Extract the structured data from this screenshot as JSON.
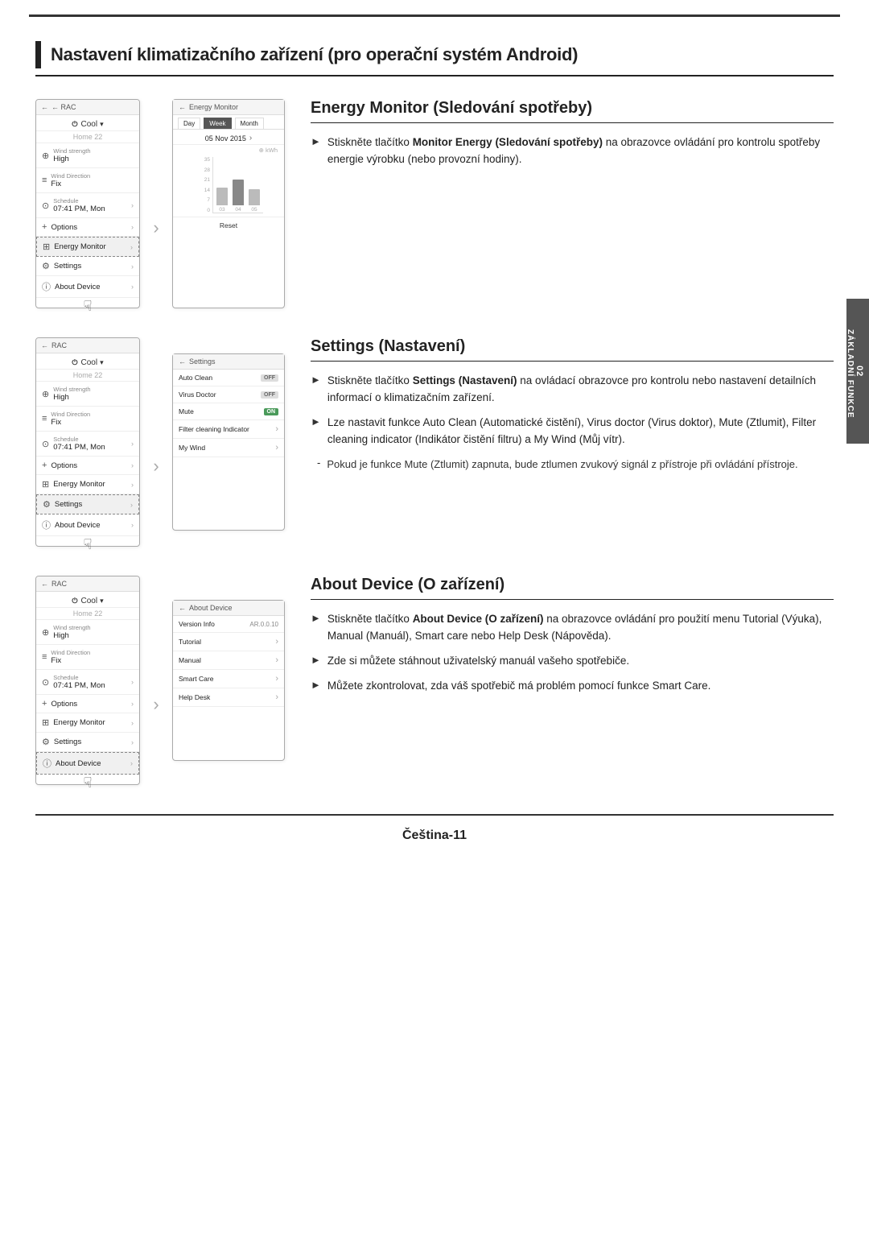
{
  "page": {
    "title": "Nastavení klimatizačního zařízení (pro operační systém Android)",
    "footer": "Čeština-11",
    "sideTab": {
      "number": "02",
      "label": "ZÁKLADNÍ FUNKCE"
    }
  },
  "sections": [
    {
      "id": "energy-monitor",
      "heading": "Energy Monitor (Sledování spotřeby)",
      "bullets": [
        {
          "text": "Stiskněte tlačítko Monitor Energy (Sledování spotřeby) na obrazovce ovládání pro kontrolu spotřeby energie výrobku (nebo provozní hodiny).",
          "bold_prefix": "Monitor Energy (Sledování spotřeby)"
        }
      ],
      "phone1": {
        "header": "← RAC",
        "mode": "Cool",
        "temp": "Home 22",
        "items": [
          {
            "icon": "wind",
            "label_small": "Wind strength",
            "label": "High",
            "arrow": true
          },
          {
            "icon": "dir",
            "label_small": "Wind Direction",
            "label": "Fix",
            "arrow": false
          },
          {
            "icon": "sched",
            "label_small": "Schedule",
            "label": "07:41 PM, Mon",
            "arrow": true
          },
          {
            "icon": "plus",
            "label": "Options",
            "arrow": true
          },
          {
            "icon": "energy",
            "label": "Energy Monitor",
            "arrow": true,
            "selected": true
          },
          {
            "icon": "gear",
            "label": "Settings",
            "arrow": true
          },
          {
            "icon": "info",
            "label": "About Device",
            "arrow": true
          }
        ]
      },
      "phone2": {
        "header": "← Energy Monitor",
        "tabs": [
          "Day",
          "Week",
          "Month"
        ],
        "activeTab": "Week",
        "date": "05 Nov 2015",
        "kwhLabel": "⊕ kWh",
        "yLabels": [
          "35",
          "28",
          "21",
          "14",
          "7",
          "0"
        ],
        "bars": [
          {
            "day": "03",
            "height": 20
          },
          {
            "day": "04",
            "height": 30
          },
          {
            "day": "05",
            "height": 18
          }
        ],
        "resetLabel": "Reset"
      }
    },
    {
      "id": "settings",
      "heading": "Settings (Nastavení)",
      "bullets": [
        {
          "text": "Stiskněte tlačítko Settings (Nastavení) na ovládací obrazovce pro kontrolu nebo nastavení detailních informací o klimatizačním zařízení.",
          "bold_prefix": "Settings (Nastavení)"
        },
        {
          "text": "Lze nastavit funkce Auto Clean (Automatické čistění), Virus doctor (Virus doktor), Mute (Ztlumit), Filter cleaning indicator (Indikátor čistění filtru) a My Wind (Můj vítr).",
          "bold_prefix": ""
        }
      ],
      "sub_bullets": [
        {
          "text": "Pokud je funkce Mute (Ztlumit) zapnuta, bude ztlumen zvukový signál z přístroje při ovládání přístroje."
        }
      ],
      "phone1": {
        "header": "← RAC",
        "mode": "Cool",
        "temp": "Home 22",
        "items": [
          {
            "icon": "wind",
            "label_small": "Wind strength",
            "label": "High",
            "arrow": true
          },
          {
            "icon": "dir",
            "label_small": "Wind Direction",
            "label": "Fix",
            "arrow": false
          },
          {
            "icon": "sched",
            "label_small": "Schedule",
            "label": "07:41 PM, Mon",
            "arrow": true
          },
          {
            "icon": "plus",
            "label": "Options",
            "arrow": true
          },
          {
            "icon": "energy",
            "label": "Energy Monitor",
            "arrow": true
          },
          {
            "icon": "gear",
            "label": "Settings",
            "arrow": true,
            "selected": true
          },
          {
            "icon": "info",
            "label": "About Device",
            "arrow": true
          }
        ]
      },
      "phone2": {
        "header": "← Settings",
        "items": [
          {
            "label": "Auto Clean",
            "toggle": "OFF",
            "toggleType": "off",
            "arrow": false
          },
          {
            "label": "Virus Doctor",
            "toggle": "OFF",
            "toggleType": "off",
            "arrow": false
          },
          {
            "label": "Mute",
            "toggle": "ON",
            "toggleType": "on",
            "arrow": false
          },
          {
            "label": "Filter cleaning Indicator",
            "toggle": "",
            "arrow": true
          },
          {
            "label": "My Wind",
            "toggle": "",
            "arrow": true
          }
        ]
      }
    },
    {
      "id": "about-device",
      "heading": "About Device (O zařízení)",
      "bullets": [
        {
          "text": "Stiskněte tlačítko About Device (O zařízení) na obrazovce ovládání pro použití menu Tutorial (Výuka), Manual (Manuál), Smart care nebo Help Desk (Nápověda).",
          "bold_prefix": "About Device (O zařízení)"
        },
        {
          "text": "Zde si můžete stáhnout uživatelský manuál vašeho spotřebiče.",
          "bold_prefix": ""
        },
        {
          "text": "Můžete zkontrolovat, zda váš spotřebič má problém pomocí funkce Smart Care.",
          "bold_prefix": ""
        }
      ],
      "phone1": {
        "header": "← RAC",
        "mode": "Cool",
        "temp": "Home 22",
        "items": [
          {
            "icon": "wind",
            "label_small": "Wind strength",
            "label": "High",
            "arrow": true
          },
          {
            "icon": "dir",
            "label_small": "Wind Direction",
            "label": "Fix",
            "arrow": false
          },
          {
            "icon": "sched",
            "label_small": "Schedule",
            "label": "07:41 PM, Mon",
            "arrow": true
          },
          {
            "icon": "plus",
            "label": "Options",
            "arrow": true
          },
          {
            "icon": "energy",
            "label": "Energy Monitor",
            "arrow": true
          },
          {
            "icon": "gear",
            "label": "Settings",
            "arrow": true
          },
          {
            "icon": "info",
            "label": "About Device",
            "arrow": true,
            "selected": true
          }
        ]
      },
      "phone2": {
        "header": "← About Device",
        "items": [
          {
            "label": "Version Info",
            "value": "AR.0.0.10",
            "arrow": false
          },
          {
            "label": "Tutorial",
            "value": "",
            "arrow": true
          },
          {
            "label": "Manual",
            "value": "",
            "arrow": true
          },
          {
            "label": "Smart Care",
            "value": "",
            "arrow": true
          },
          {
            "label": "Help Desk",
            "value": "",
            "arrow": true
          }
        ]
      }
    }
  ],
  "icons": {
    "wind": "⊕",
    "dir": "≡",
    "sched": "⊙",
    "plus": "+",
    "energy": "⊞",
    "gear": "⚙",
    "info": "ⓘ",
    "back_arrow": "←",
    "right_arrow": "›",
    "section_arrow": "▶",
    "bullet_arrow": "►"
  }
}
